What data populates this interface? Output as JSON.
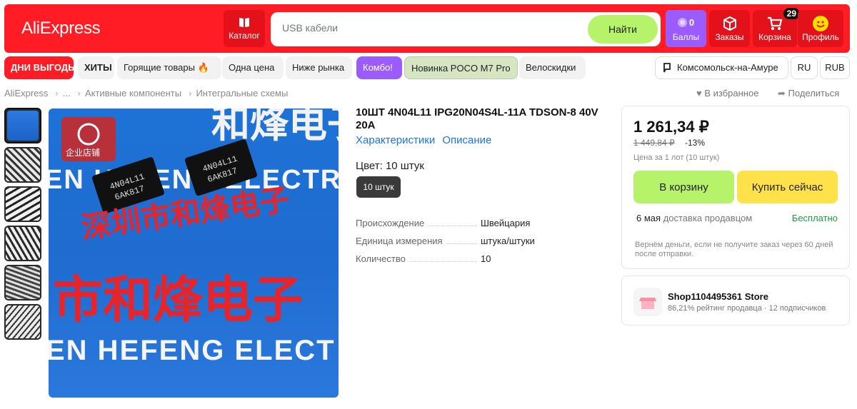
{
  "header": {
    "logo": "AliExpress",
    "catalog_label": "Каталог",
    "search_placeholder": "USB кабели",
    "search_button": "Найти",
    "points_count": "0",
    "points_label": "Баллы",
    "orders_label": "Заказы",
    "cart_label": "Корзина",
    "cart_count": "29",
    "profile_label": "Профиль"
  },
  "tags": [
    "ДНИ ВЫГОДЫ",
    "ХИТЫ",
    "Горящие товары 🔥",
    "Одна цена",
    "Ниже рынка",
    "Комбо!",
    "Новинка POCO M7 Pro",
    "Велоскидки"
  ],
  "location": {
    "city": "Комсомольск-на-Амуре",
    "language": "RU",
    "currency": "RUB"
  },
  "breadcrumb": [
    "AliExpress",
    "...",
    "Активные компоненты",
    "Интегральные схемы"
  ],
  "actions": {
    "favorite": "В избранное",
    "share": "Поделиться"
  },
  "image": {
    "watermark_line1": "EN HEFENG ELECTRO",
    "watermark_cn": "深圳市和烽电子",
    "watermark_big": "市和烽电子",
    "watermark_line2": "EN HEFENG ELECT",
    "badge": "企业店铺",
    "chip1_line1": "4N04L11",
    "chip1_line2": "6AK817",
    "chip2_line1": "4N04L11",
    "chip2_line2": "6AK817",
    "top_cn": "和烽电子"
  },
  "product": {
    "title": "10ШТ 4N04L11 IPG20N04S4L-11A TDSON-8 40V 20A",
    "tab_specs": "Характеристики",
    "tab_desc": "Описание",
    "color_label": "Цвет: 10 штук",
    "color_option": "10 штук",
    "specs": [
      {
        "key": "Происхождение",
        "value": "Швейцария"
      },
      {
        "key": "Единица измерения",
        "value": "штука/штуки"
      },
      {
        "key": "Количество",
        "value": "10"
      }
    ]
  },
  "buybox": {
    "price": "1 261,34 ₽",
    "old_price": "1 449,84 ₽",
    "discount": "-13%",
    "lot_note": "Цена за 1 лот (10 штук)",
    "add_to_cart": "В корзину",
    "buy_now": "Купить сейчас",
    "delivery_date": "6 мая",
    "delivery_by": "доставка продавцом",
    "delivery_cost": "Бесплатно",
    "refund_note": "Вернём деньги, если не получите заказ через 60 дней после отправки."
  },
  "store": {
    "name": "Shop1104495361 Store",
    "rating": "86,21% рейтинг продавца",
    "followers": "12 подписчиков"
  },
  "colors": {
    "brand_red": "#ff1c24",
    "accent_green": "#b7f36a",
    "accent_yellow": "#ffe24a",
    "points_purple": "#9b5cff",
    "link_blue": "#1a73e8"
  }
}
